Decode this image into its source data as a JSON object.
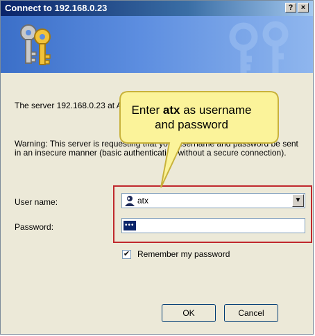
{
  "window": {
    "title": "Connect to 192.168.0.23",
    "help_glyph": "?",
    "close_glyph": "×"
  },
  "dialog": {
    "server_text": "The server 192.168.0.23 at ATX requires a username and password.",
    "warning_text": "Warning: This server is requesting that your username and password be sent in an insecure manner (basic authentication without a secure connection).",
    "username_label": "User name:",
    "username_value": "atx",
    "password_label": "Password:",
    "password_value": "•••",
    "remember_checked_glyph": "✔",
    "remember_label": "Remember my password",
    "ok_label": "OK",
    "cancel_label": "Cancel"
  },
  "callout": {
    "part1": "Enter ",
    "bold": "atx",
    "part2": " as username",
    "line2": "and password"
  },
  "icons": {
    "keys": "keys-icon",
    "user": "user-icon",
    "dropdown": "chevron-down-icon",
    "checkbox": "checkbox-icon"
  },
  "colors": {
    "title_bar": "#0a246a",
    "banner": "#5d8ee0",
    "highlight_box": "#c0282d",
    "callout_fill": "#fbf39a",
    "callout_border": "#c8b23c",
    "dialog_bg": "#ece9d8"
  }
}
